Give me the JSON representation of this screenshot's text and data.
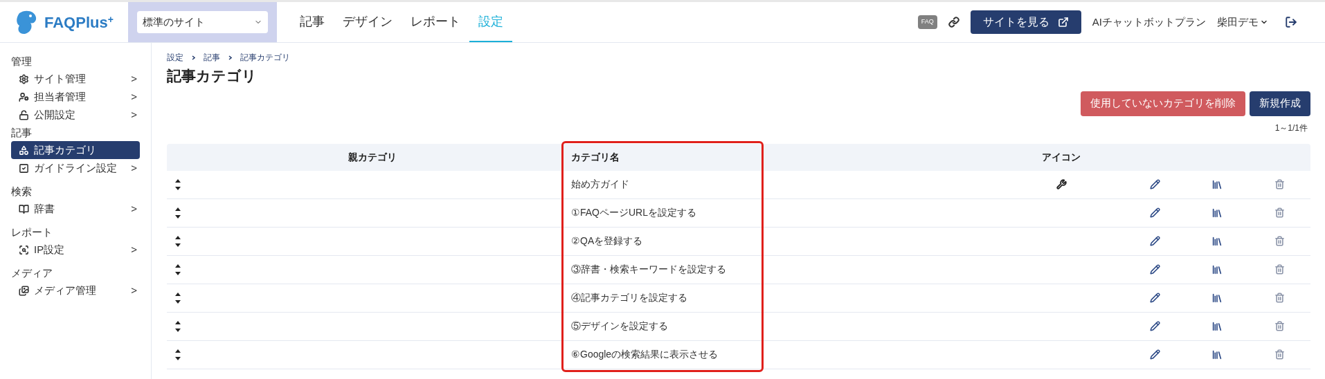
{
  "header": {
    "logo": {
      "text": "FAQPlus",
      "superscript": "+"
    },
    "site_select": {
      "value": "標準のサイト"
    },
    "nav": [
      {
        "label": "記事",
        "selected": false
      },
      {
        "label": "デザイン",
        "selected": false
      },
      {
        "label": "レポート",
        "selected": false
      },
      {
        "label": "設定",
        "selected": true
      }
    ],
    "faq_badge": "FAQ",
    "view_site_button": "サイトを見る",
    "plan": "AIチャットボットプラン",
    "user": "柴田デモ"
  },
  "sidebar": [
    {
      "heading": "管理",
      "items": [
        {
          "label": "サイト管理",
          "selected": false,
          "arrow": ">"
        },
        {
          "label": "担当者管理",
          "selected": false,
          "arrow": ">"
        },
        {
          "label": "公開設定",
          "selected": false,
          "arrow": ">"
        }
      ]
    },
    {
      "heading": "記事",
      "items": [
        {
          "label": "記事カテゴリ",
          "selected": true
        },
        {
          "label": "ガイドライン設定",
          "selected": false,
          "arrow": ">"
        }
      ]
    },
    {
      "heading": "検索",
      "items": [
        {
          "label": "辞書",
          "selected": false,
          "arrow": ">"
        }
      ]
    },
    {
      "heading": "レポート",
      "items": [
        {
          "label": "IP設定",
          "selected": false,
          "arrow": ">"
        }
      ]
    },
    {
      "heading": "メディア",
      "items": [
        {
          "label": "メディア管理",
          "selected": false,
          "arrow": ">"
        }
      ]
    }
  ],
  "breadcrumb": [
    "設定",
    "記事",
    "記事カテゴリ"
  ],
  "title": "記事カテゴリ",
  "buttons": [
    {
      "label": "使用していないカテゴリを削除",
      "kind": "danger"
    },
    {
      "label": "新規作成",
      "kind": "primary"
    }
  ],
  "count": "1～1/1件",
  "table": {
    "columns": [
      {
        "label": "親カテゴリ",
        "highlighted": false
      },
      {
        "label": "カテゴリ名",
        "highlighted": true
      },
      {
        "label": "アイコン",
        "highlighted": false
      }
    ],
    "rows": [
      {
        "name": "始め方ガイド",
        "has_icon": true
      },
      {
        "name": "①FAQページURLを設定する",
        "has_icon": false
      },
      {
        "name": "②QAを登録する",
        "has_icon": false
      },
      {
        "name": "③辞書・検索キーワードを設定する",
        "has_icon": false
      },
      {
        "name": "④記事カテゴリを設定する",
        "has_icon": false
      },
      {
        "name": "⑤デザインを設定する",
        "has_icon": false
      },
      {
        "name": "⑥Googleの検索結果に表示させる",
        "has_icon": false
      }
    ]
  }
}
